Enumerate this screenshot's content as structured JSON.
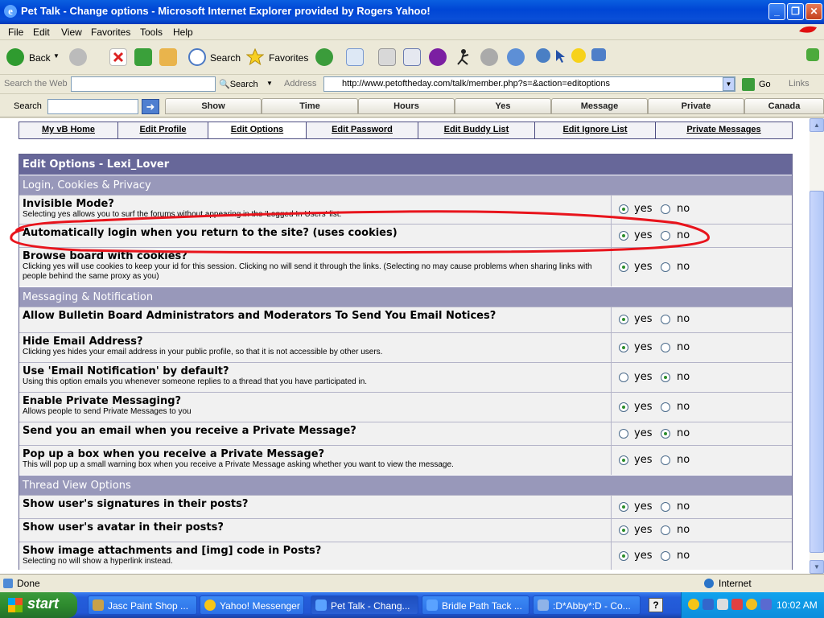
{
  "window": {
    "title": "Pet Talk - Change options - Microsoft Internet Explorer provided by Rogers Yahoo!"
  },
  "menu": [
    "File",
    "Edit",
    "View",
    "Favorites",
    "Tools",
    "Help"
  ],
  "toolbar": {
    "back": "Back",
    "search": "Search",
    "favorites": "Favorites"
  },
  "searchbar": {
    "label": "Search the Web",
    "search_btn": "Search",
    "address_label": "Address",
    "url": "http://www.petoftheday.com/talk/member.php?s=&action=editoptions",
    "go": "Go",
    "links": "Links"
  },
  "linkbar": {
    "label": "Search",
    "tabs": [
      "Show",
      "Time",
      "Hours",
      "Yes",
      "Message",
      "Private",
      "Canada"
    ]
  },
  "nav": [
    "My vB Home",
    "Edit Profile",
    "Edit Options",
    "Edit Password",
    "Edit Buddy List",
    "Edit Ignore List",
    "Private Messages"
  ],
  "page": {
    "header": "Edit Options - Lexi_Lover",
    "yes": "yes",
    "no": "no",
    "sections": [
      {
        "title": "Login, Cookies & Privacy",
        "rows": [
          {
            "title": "Invisible Mode?",
            "desc": "Selecting yes allows you to surf the forums without appearing in the 'Logged In Users' list.",
            "value": "yes"
          },
          {
            "title": "Automatically login when you return to the site? (uses cookies)",
            "desc": "",
            "value": "yes"
          },
          {
            "title": "Browse board with cookies?",
            "desc": "Clicking yes will use cookies to keep your id for this session. Clicking no will send it through the links. (Selecting no may cause problems when sharing links with people behind the same proxy as you)",
            "value": "yes"
          }
        ]
      },
      {
        "title": "Messaging & Notification",
        "rows": [
          {
            "title": "Allow Bulletin Board Administrators and Moderators To Send You Email Notices?",
            "desc": "",
            "value": "yes"
          },
          {
            "title": "Hide Email Address?",
            "desc": "Clicking yes hides your email address in your public profile, so that it is not accessible by other users.",
            "value": "yes"
          },
          {
            "title": "Use 'Email Notification' by default?",
            "desc": "Using this option emails you whenever someone replies to a thread that you have participated in.",
            "value": "no"
          },
          {
            "title": "Enable Private Messaging?",
            "desc": "Allows people to send Private Messages to you",
            "value": "yes"
          },
          {
            "title": "Send you an email when you receive a Private Message?",
            "desc": "",
            "value": "no"
          },
          {
            "title": "Pop up a box when you receive a Private Message?",
            "desc": "This will pop up a small warning box when you receive a Private Message asking whether you want to view the message.",
            "value": "yes"
          }
        ]
      },
      {
        "title": "Thread View Options",
        "rows": [
          {
            "title": "Show user's signatures in their posts?",
            "desc": "",
            "value": "yes"
          },
          {
            "title": "Show user's avatar in their posts?",
            "desc": "",
            "value": "yes"
          },
          {
            "title": "Show image attachments and [img] code in Posts?",
            "desc": "Selecting no will show a hyperlink instead.",
            "value": "yes"
          }
        ]
      }
    ]
  },
  "status": {
    "text": "Done",
    "zone": "Internet"
  },
  "taskbar": {
    "start": "start",
    "tasks": [
      "Jasc Paint Shop ...",
      "Yahoo! Messenger",
      "Pet Talk - Chang...",
      "Bridle Path Tack ...",
      ":D*Abby*:D - Co..."
    ],
    "clock": "10:02 AM"
  },
  "colors": {
    "highlight_circle": "#e8141c",
    "header_bg": "#676799",
    "section_bg": "#9898ba"
  }
}
